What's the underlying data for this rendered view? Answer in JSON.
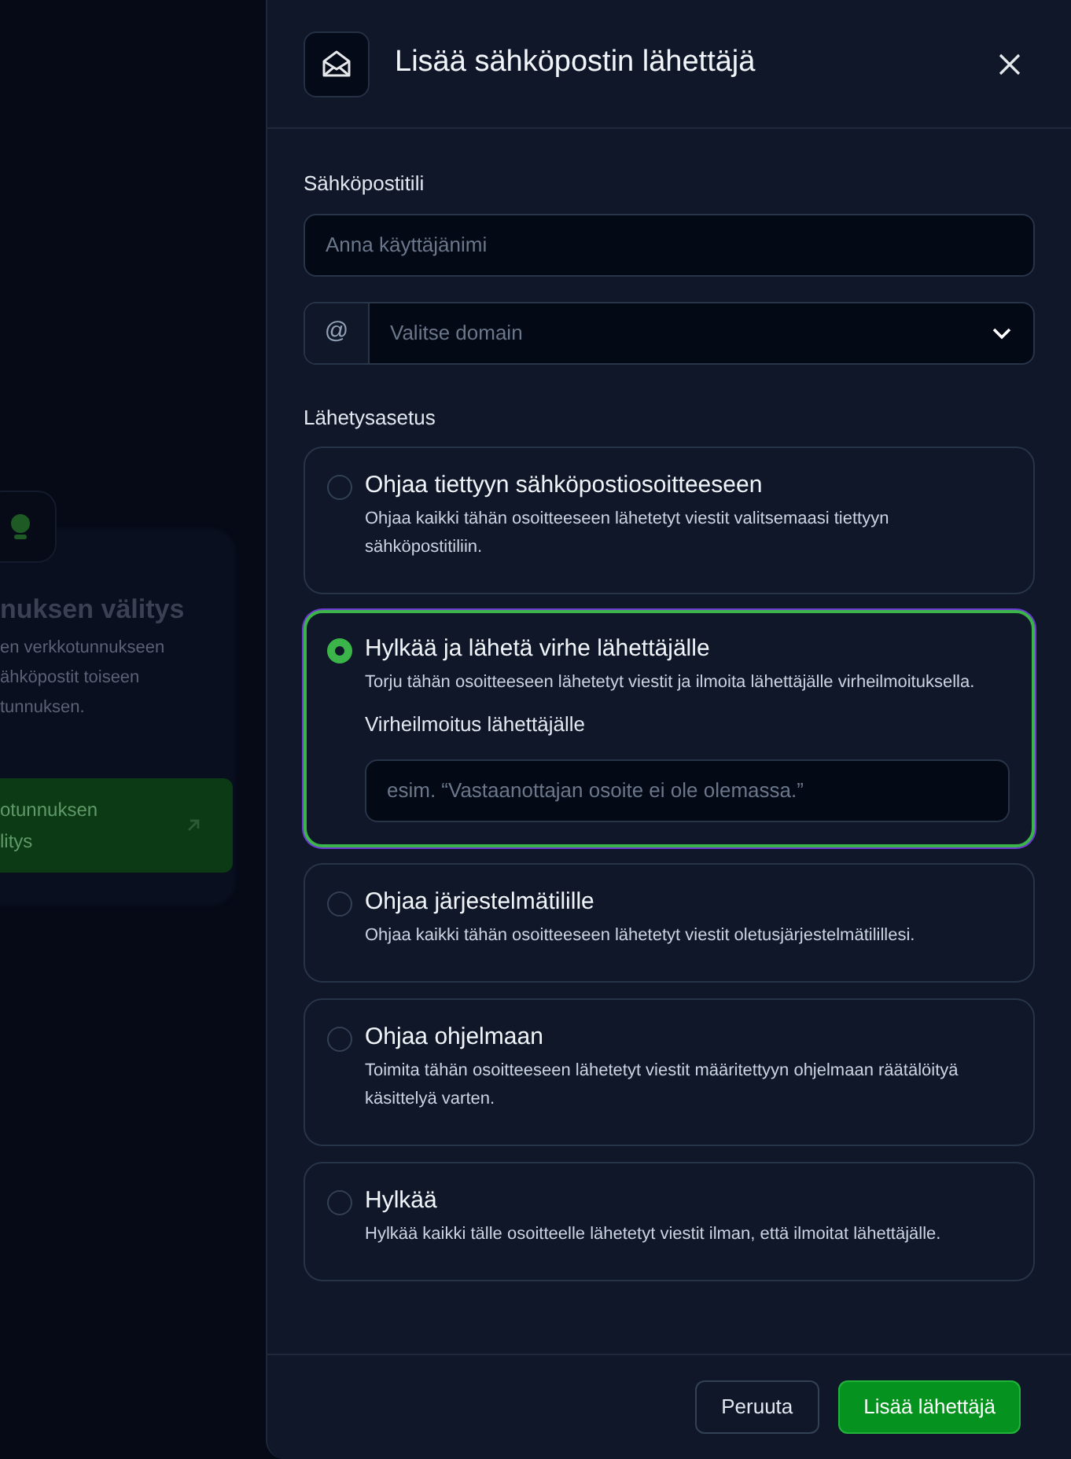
{
  "background": {
    "card_title": "nuksen välitys",
    "card_text": [
      "en verkkotunnukseen",
      "ähköpostit toiseen",
      "tunnuksen."
    ],
    "card_button": "otunnuksen\nlitys"
  },
  "dialog": {
    "title": "Lisää sähköpostin lähettäjä",
    "account": {
      "label": "Sähköpostitili",
      "username_placeholder": "Anna käyttäjänimi",
      "at_sign": "@",
      "domain_placeholder": "Valitse domain"
    },
    "delivery": {
      "label": "Lähetysasetus",
      "options": [
        {
          "title": "Ohjaa tiettyyn sähköpostiosoitteeseen",
          "description": "Ohjaa kaikki tähän osoitteeseen lähetetyt viestit valitsemaasi tiettyyn sähköpostitiliin.",
          "selected": false
        },
        {
          "title": "Hylkää ja lähetä virhe lähettäjälle",
          "description": "Torju tähän osoitteeseen lähetetyt viestit ja ilmoita lähettäjälle virheilmoituksella.",
          "selected": true,
          "field": {
            "label": "Virheilmoitus lähettäjälle",
            "placeholder": "esim. “Vastaanottajan osoite ei ole olemassa.”"
          }
        },
        {
          "title": "Ohjaa järjestelmätilille",
          "description": "Ohjaa kaikki tähän osoitteeseen lähetetyt viestit oletusjärjestelmätilillesi.",
          "selected": false
        },
        {
          "title": "Ohjaa ohjelmaan",
          "description": "Toimita tähän osoitteeseen lähetetyt viestit määritettyyn ohjelmaan räätälöityä käsittelyä varten.",
          "selected": false
        },
        {
          "title": "Hylkää",
          "description": "Hylkää kaikki tälle osoitteelle lähetetyt viestit ilman, että ilmoitat lähettäjälle.",
          "selected": false
        }
      ]
    },
    "buttons": {
      "cancel": "Peruuta",
      "submit": "Lisää lähettäjä"
    }
  }
}
